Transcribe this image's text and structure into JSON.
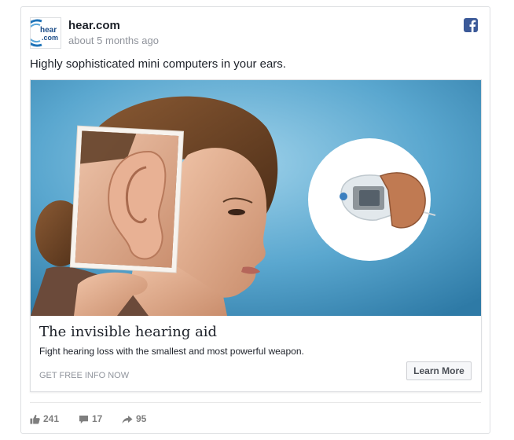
{
  "post": {
    "page_name": "hear.com",
    "timestamp": "about 5 months ago",
    "text": "Highly sophisticated mini computers in your ears.",
    "avatar_logo": {
      "line1": "hear",
      "line2": ".com"
    },
    "platform_icon": "facebook-icon"
  },
  "ad": {
    "headline": "The invisible hearing aid",
    "description": "Fight hearing loss with the smallest and most powerful weapon.",
    "cta_caption": "GET FREE INFO NOW",
    "button_label": "Learn More",
    "image_description_icons": [
      "ear-photo",
      "hearing-aid-device"
    ]
  },
  "stats": {
    "likes": "241",
    "comments": "17",
    "shares": "95"
  },
  "colors": {
    "brand_blue": "#3b5998",
    "image_background": "#4a9ac2",
    "hearing_aid_copper": "#c07a52"
  }
}
